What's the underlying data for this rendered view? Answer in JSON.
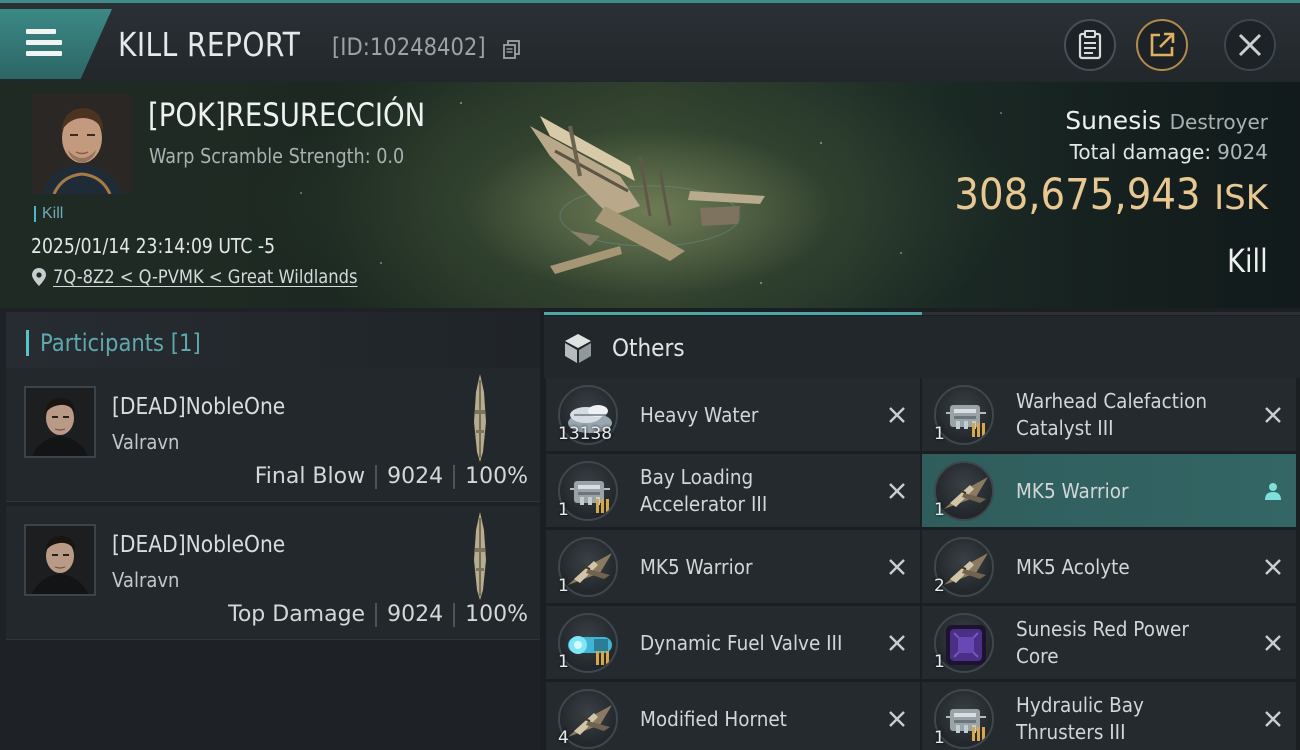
{
  "header": {
    "title": "KILL REPORT",
    "report_id": "[ID:10248402]"
  },
  "victim": {
    "name": "[POK]RESURECCIÓN",
    "warp_scramble": "Warp Scramble Strength: 0.0",
    "kill_tag": "Kill",
    "time": "2025/01/14 23:14:09 UTC -5",
    "location": "7Q-8Z2 < Q-PVMK < Great Wildlands",
    "ship_name": "Sunesis",
    "ship_class": "Destroyer",
    "total_damage_label": "Total damage:",
    "total_damage": "9024",
    "isk_value": "308,675,943",
    "isk_unit": "ISK",
    "result": "Kill"
  },
  "participants": {
    "label": "Participants",
    "count": "[1]",
    "items": [
      {
        "name": "[DEAD]NobleOne",
        "ship": "Valravn",
        "role": "Final Blow",
        "damage": "9024",
        "percent": "100%"
      },
      {
        "name": "[DEAD]NobleOne",
        "ship": "Valravn",
        "role": "Top Damage",
        "damage": "9024",
        "percent": "100%"
      }
    ]
  },
  "others": {
    "label": "Others",
    "progress": 0.5,
    "items": [
      {
        "name": "Heavy Water",
        "qty": "13138",
        "icon": "ice-crystals-icon",
        "mark": "close-icon"
      },
      {
        "name": "Warhead Calefaction Catalyst III",
        "qty": "1",
        "icon": "module-icon",
        "mark": "close-icon"
      },
      {
        "name": "Bay Loading Accelerator III",
        "qty": "1",
        "icon": "module-icon",
        "mark": "close-icon"
      },
      {
        "name": "MK5  Warrior",
        "qty": "1",
        "icon": "drone-icon",
        "mark": "person-icon"
      },
      {
        "name": "MK5  Warrior",
        "qty": "1",
        "icon": "drone-icon",
        "mark": "close-icon"
      },
      {
        "name": "MK5  Acolyte",
        "qty": "2",
        "icon": "drone-icon",
        "mark": "close-icon"
      },
      {
        "name": "Dynamic Fuel Valve III",
        "qty": "1",
        "icon": "fuel-valve-icon",
        "mark": "close-icon"
      },
      {
        "name": "Sunesis Red Power Core",
        "qty": "1",
        "icon": "power-core-icon",
        "mark": "close-icon"
      },
      {
        "name": "Modified Hornet",
        "qty": "4",
        "icon": "drone-icon",
        "mark": "close-icon"
      },
      {
        "name": "Hydraulic Bay Thrusters III",
        "qty": "1",
        "icon": "module-icon",
        "mark": "close-icon"
      }
    ]
  },
  "colors": {
    "accent": "#3f8c8a",
    "isk": "#e8c892",
    "highlight_row": "#2f5d5c"
  }
}
